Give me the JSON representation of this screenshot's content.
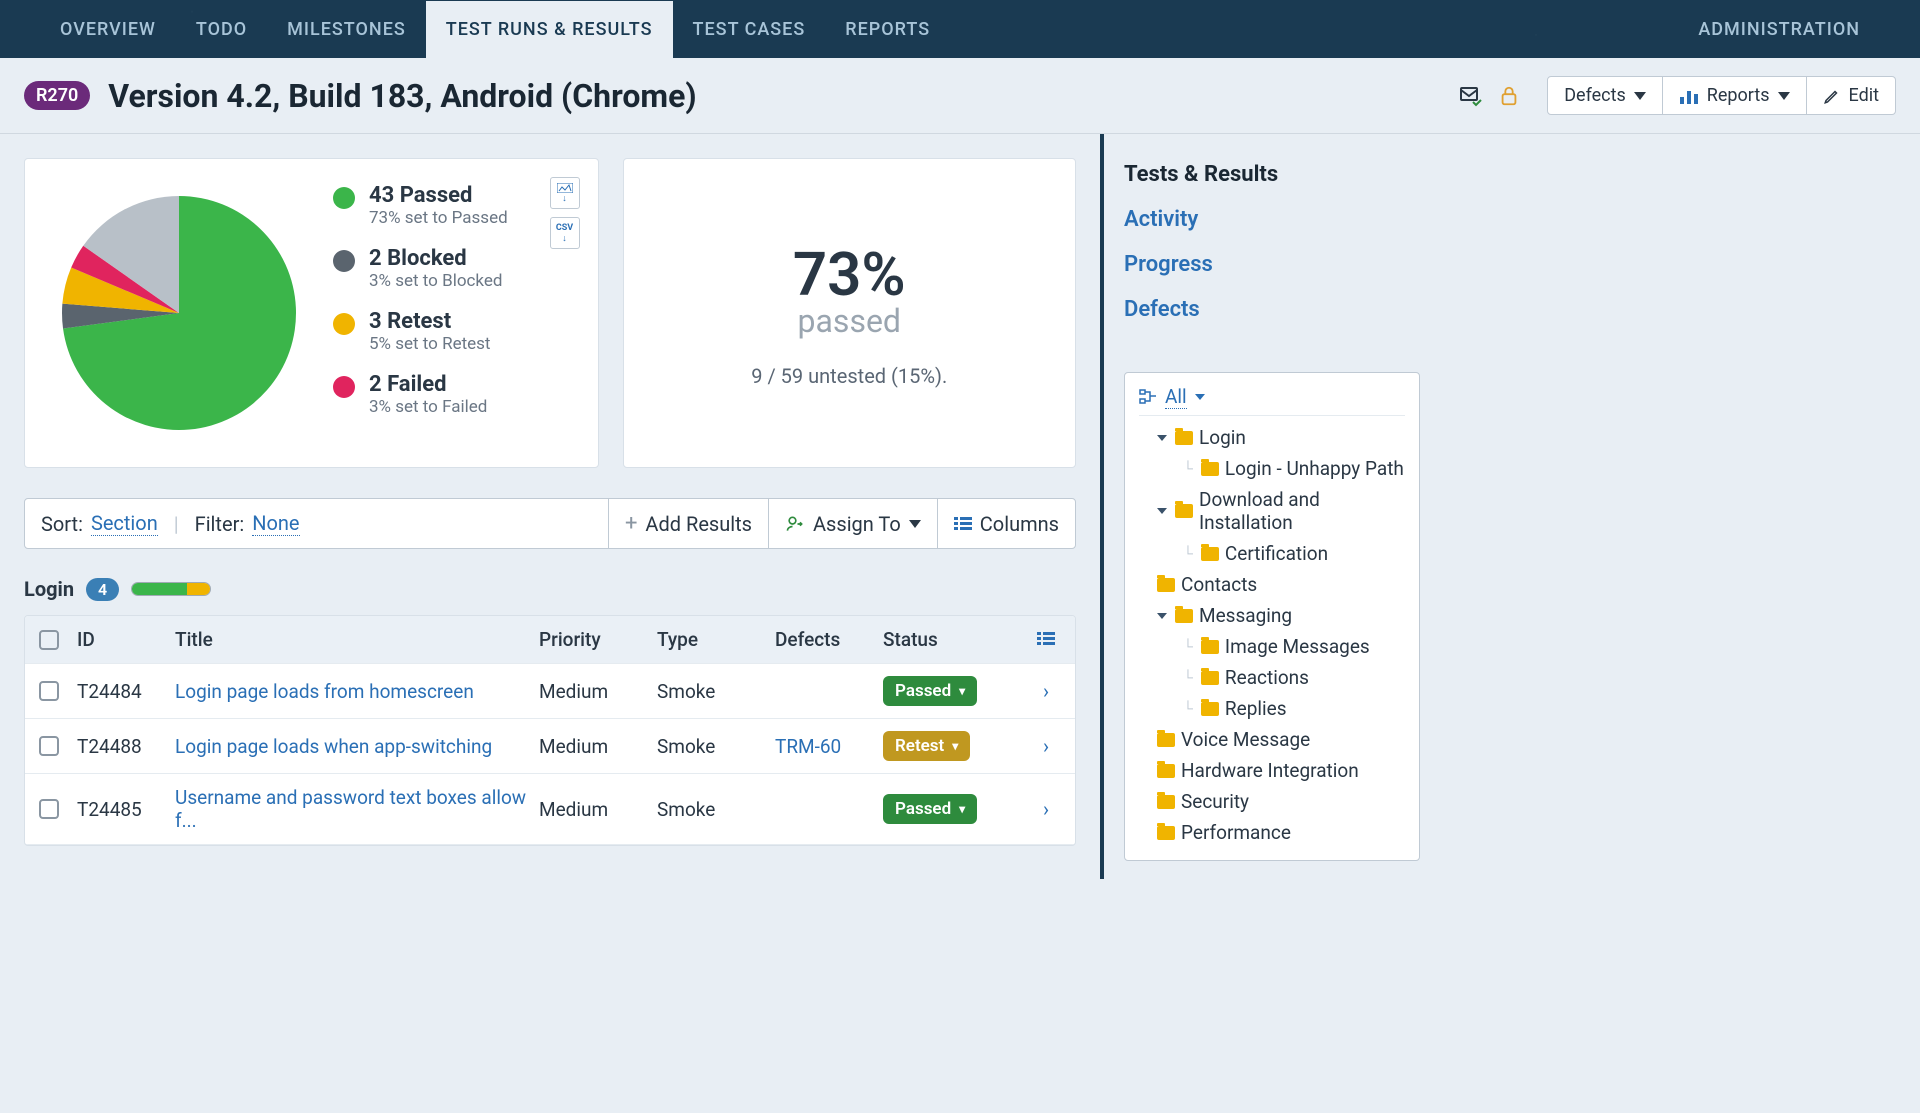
{
  "nav": {
    "items": [
      "OVERVIEW",
      "TODO",
      "MILESTONES",
      "TEST RUNS & RESULTS",
      "TEST CASES",
      "REPORTS"
    ],
    "active_index": 3,
    "admin": "ADMINISTRATION"
  },
  "header": {
    "run_badge": "R270",
    "title": "Version 4.2, Build 183, Android (Chrome)",
    "buttons": {
      "defects": "Defects",
      "reports": "Reports",
      "edit": "Edit"
    }
  },
  "chart_data": {
    "type": "pie",
    "title": "",
    "series": [
      {
        "name": "Passed",
        "value": 43,
        "pct": 73,
        "color": "#3bb54a",
        "sub": "73% set to Passed"
      },
      {
        "name": "Blocked",
        "value": 2,
        "pct": 3,
        "color": "#5a646e",
        "sub": "3% set to Blocked"
      },
      {
        "name": "Retest",
        "value": 3,
        "pct": 5,
        "color": "#f0b400",
        "sub": "5% set to Retest"
      },
      {
        "name": "Failed",
        "value": 2,
        "pct": 3,
        "color": "#e0245e",
        "sub": "3% set to Failed"
      },
      {
        "name": "Untested",
        "value": 9,
        "pct": 15,
        "color": "#b8c0c8",
        "sub": ""
      }
    ]
  },
  "summary": {
    "pct": "73%",
    "pct_label": "passed",
    "sub": "9 / 59 untested (15%).",
    "export": {
      "img": "",
      "csv": "CSV"
    }
  },
  "toolbar": {
    "sort_prefix": "Sort: ",
    "sort_value": "Section",
    "filter_prefix": "Filter: ",
    "filter_value": "None",
    "add_results": "Add Results",
    "assign_to": "Assign To",
    "columns": "Columns"
  },
  "section": {
    "name": "Login",
    "count": "4"
  },
  "grid": {
    "headers": {
      "id": "ID",
      "title": "Title",
      "priority": "Priority",
      "type": "Type",
      "defects": "Defects",
      "status": "Status"
    },
    "rows": [
      {
        "id": "T24484",
        "title": "Login page loads from homescreen",
        "priority": "Medium",
        "type": "Smoke",
        "defects": "",
        "status": "Passed",
        "status_class": "passed"
      },
      {
        "id": "T24488",
        "title": "Login page loads when app-switching",
        "priority": "Medium",
        "type": "Smoke",
        "defects": "TRM-60",
        "status": "Retest",
        "status_class": "retest"
      },
      {
        "id": "T24485",
        "title": "Username and password text boxes allow f...",
        "priority": "Medium",
        "type": "Smoke",
        "defects": "",
        "status": "Passed",
        "status_class": "passed"
      }
    ]
  },
  "right": {
    "links": [
      {
        "label": "Tests & Results",
        "active": true
      },
      {
        "label": "Activity",
        "active": false
      },
      {
        "label": "Progress",
        "active": false
      },
      {
        "label": "Defects",
        "active": false
      }
    ],
    "tree_all": "All",
    "tree": [
      {
        "label": "Login",
        "level": 1,
        "caret": true
      },
      {
        "label": "Login - Unhappy Path",
        "level": 2,
        "caret": false
      },
      {
        "label": "Download and Installation",
        "level": 1,
        "caret": true
      },
      {
        "label": "Certification",
        "level": 2,
        "caret": false
      },
      {
        "label": "Contacts",
        "level": 1,
        "caret": false
      },
      {
        "label": "Messaging",
        "level": 1,
        "caret": true
      },
      {
        "label": "Image Messages",
        "level": 2,
        "caret": false
      },
      {
        "label": "Reactions",
        "level": 2,
        "caret": false
      },
      {
        "label": "Replies",
        "level": 2,
        "caret": false
      },
      {
        "label": "Voice Message",
        "level": 1,
        "caret": false
      },
      {
        "label": "Hardware Integration",
        "level": 1,
        "caret": false
      },
      {
        "label": "Security",
        "level": 1,
        "caret": false
      },
      {
        "label": "Performance",
        "level": 1,
        "caret": false
      }
    ]
  }
}
